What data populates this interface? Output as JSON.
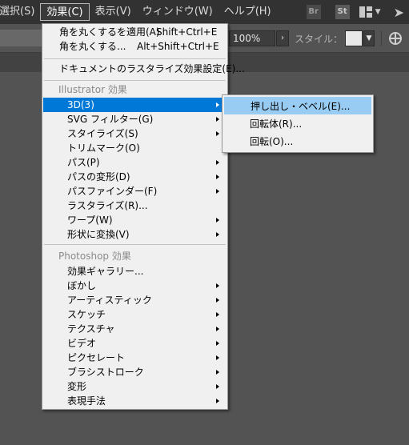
{
  "menubar": {
    "items": [
      "選択(S)",
      "効果(C)",
      "表示(V)",
      "ウィンドウ(W)",
      "ヘルプ(H)"
    ],
    "right": {
      "br": "Br",
      "st": "St"
    }
  },
  "toolbar": {
    "zoom": "100%",
    "zoom_arrow": "›",
    "style_label": "スタイル："
  },
  "effect_menu": {
    "apply_round": {
      "label": "角を丸くするを適用(A)",
      "shortcut": "Shift+Ctrl+E"
    },
    "round": {
      "label": "角を丸くする...",
      "shortcut": "Alt+Shift+Ctrl+E"
    },
    "rasterize_settings": "ドキュメントのラスタライズ効果設定(E)...",
    "illustrator_header": "Illustrator 効果",
    "illustrator_items": [
      "3D(3)",
      "SVG フィルター(G)",
      "スタイライズ(S)",
      "トリムマーク(O)",
      "パス(P)",
      "パスの変形(D)",
      "パスファインダー(F)",
      "ラスタライズ(R)...",
      "ワープ(W)",
      "形状に変換(V)"
    ],
    "photoshop_header": "Photoshop 効果",
    "photoshop_items": [
      "効果ギャラリー...",
      "ぼかし",
      "アーティスティック",
      "スケッチ",
      "テクスチャ",
      "ビデオ",
      "ピクセレート",
      "ブラシストローク",
      "変形",
      "表現手法"
    ]
  },
  "submenu_3d": {
    "items": [
      "押し出し・ベベル(E)...",
      "回転体(R)...",
      "回転(O)..."
    ]
  }
}
